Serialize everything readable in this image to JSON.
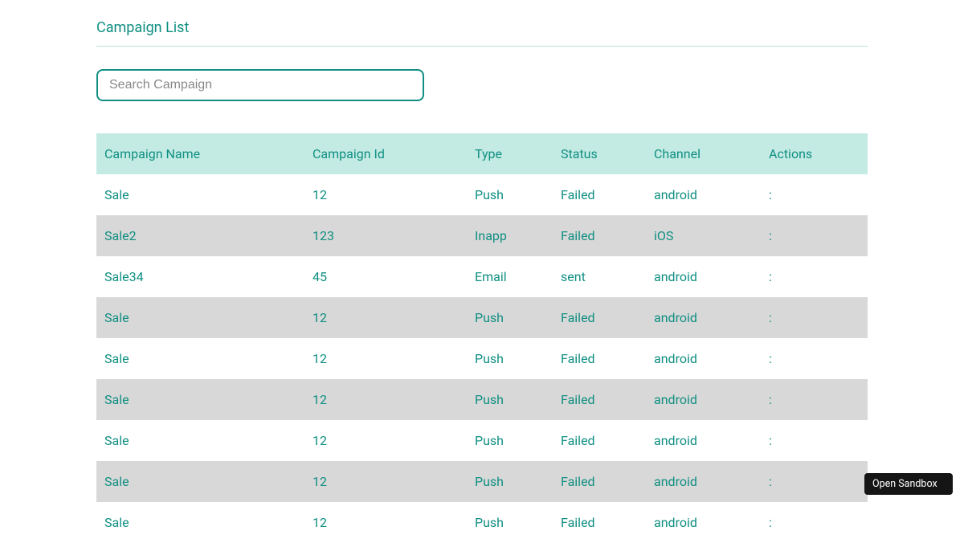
{
  "page": {
    "title": "Campaign List"
  },
  "search": {
    "placeholder": "Search Campaign",
    "value": ""
  },
  "table": {
    "headers": {
      "name": "Campaign Name",
      "id": "Campaign Id",
      "type": "Type",
      "status": "Status",
      "channel": "Channel",
      "actions": "Actions"
    },
    "rows": [
      {
        "name": "Sale",
        "id": "12",
        "type": "Push",
        "status": "Failed",
        "channel": "android",
        "actions": ":"
      },
      {
        "name": "Sale2",
        "id": "123",
        "type": "Inapp",
        "status": "Failed",
        "channel": "iOS",
        "actions": ":"
      },
      {
        "name": "Sale34",
        "id": "45",
        "type": "Email",
        "status": "sent",
        "channel": "android",
        "actions": ":"
      },
      {
        "name": "Sale",
        "id": "12",
        "type": "Push",
        "status": "Failed",
        "channel": "android",
        "actions": ":"
      },
      {
        "name": "Sale",
        "id": "12",
        "type": "Push",
        "status": "Failed",
        "channel": "android",
        "actions": ":"
      },
      {
        "name": "Sale",
        "id": "12",
        "type": "Push",
        "status": "Failed",
        "channel": "android",
        "actions": ":"
      },
      {
        "name": "Sale",
        "id": "12",
        "type": "Push",
        "status": "Failed",
        "channel": "android",
        "actions": ":"
      },
      {
        "name": "Sale",
        "id": "12",
        "type": "Push",
        "status": "Failed",
        "channel": "android",
        "actions": ":"
      },
      {
        "name": "Sale",
        "id": "12",
        "type": "Push",
        "status": "Failed",
        "channel": "android",
        "actions": ":"
      }
    ]
  },
  "sandbox": {
    "label": "Open Sandbox"
  }
}
